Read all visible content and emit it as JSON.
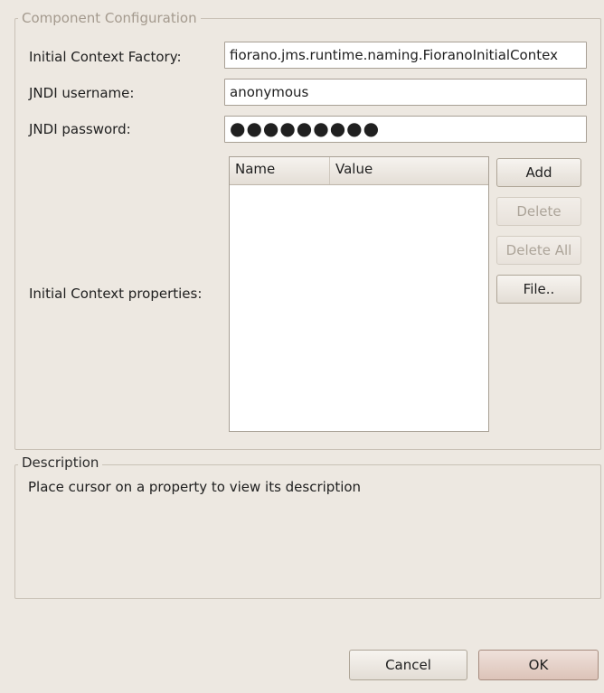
{
  "config": {
    "group_title": "Component Configuration",
    "factory": {
      "label": "Initial Context Factory:",
      "value": "fiorano.jms.runtime.naming.FioranoInitialContex"
    },
    "username": {
      "label": "JNDI username:",
      "value": "anonymous"
    },
    "password": {
      "label": "JNDI password:",
      "value": "●●●●●●●●●"
    },
    "properties": {
      "label": "Initial Context properties:",
      "columns": [
        "Name",
        "Value"
      ],
      "rows": []
    },
    "buttons": {
      "add": "Add",
      "delete": "Delete",
      "delete_all": "Delete All",
      "file": "File.."
    }
  },
  "description": {
    "group_title": "Description",
    "text": "Place cursor on a property to view its description"
  },
  "footer": {
    "cancel": "Cancel",
    "ok": "OK"
  }
}
